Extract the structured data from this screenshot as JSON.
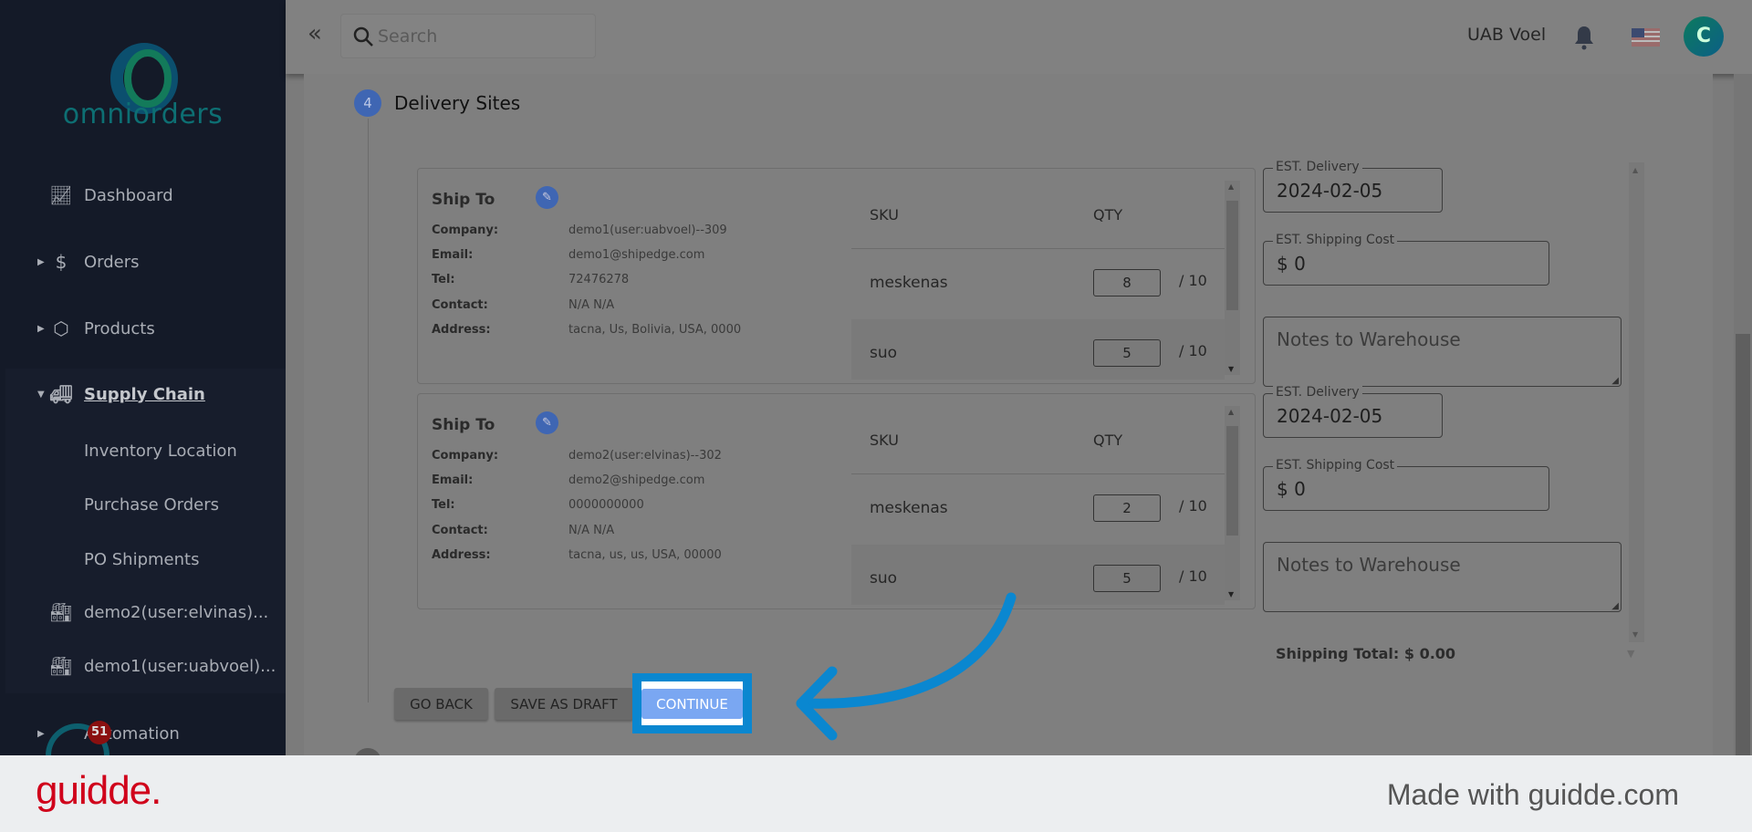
{
  "brand": {
    "name": "omniorders"
  },
  "sidebar": {
    "items": [
      {
        "label": "Dashboard",
        "icon": "chart-line-icon"
      },
      {
        "label": "Orders",
        "icon": "dollar-icon"
      },
      {
        "label": "Products",
        "icon": "box-icon"
      },
      {
        "label": "Supply Chain",
        "icon": "truck-icon"
      },
      {
        "label": "Inventory Location"
      },
      {
        "label": "Purchase Orders"
      },
      {
        "label": "PO Shipments"
      },
      {
        "label": "demo2(user:elvinas)...",
        "icon": "warehouse-icon"
      },
      {
        "label": "demo1(user:uabvoel)...",
        "icon": "warehouse-icon"
      },
      {
        "label": "Automation",
        "icon": "gear-icon"
      }
    ],
    "badge": "51"
  },
  "header": {
    "search_placeholder": "Search",
    "company": "UAB Voel",
    "avatar_initial": "C"
  },
  "step": {
    "number": "4",
    "title": "Delivery Sites"
  },
  "labels": {
    "ship_to": "Ship To",
    "company": "Company:",
    "email": "Email:",
    "tel": "Tel:",
    "contact": "Contact:",
    "address": "Address:",
    "sku": "SKU",
    "qty": "QTY",
    "est_delivery": "EST. Delivery",
    "est_cost": "EST. Shipping Cost",
    "notes_placeholder": "Notes to Warehouse"
  },
  "sites": [
    {
      "company": "demo1(user:uabvoel)--309",
      "email": "demo1@shipedge.com",
      "tel": "72476278",
      "contact": "N/A N/A",
      "address": "tacna, Us, Bolivia, USA, 0000",
      "items": [
        {
          "sku": "meskenas",
          "qty": "8",
          "max": "/ 10"
        },
        {
          "sku": "suo",
          "qty": "5",
          "max": "/ 10"
        }
      ],
      "est_delivery": "2024-02-05",
      "est_cost": "$ 0"
    },
    {
      "company": "demo2(user:elvinas)--302",
      "email": "demo2@shipedge.com",
      "tel": "0000000000",
      "contact": "N/A N/A",
      "address": "tacna, us, us, USA, 00000",
      "items": [
        {
          "sku": "meskenas",
          "qty": "2",
          "max": "/ 10"
        },
        {
          "sku": "suo",
          "qty": "5",
          "max": "/ 10"
        }
      ],
      "est_delivery": "2024-02-05",
      "est_cost": "$ 0"
    }
  ],
  "shipping_total": "Shipping Total: $ 0.00",
  "actions": {
    "go_back": "GO BACK",
    "save_draft": "SAVE AS DRAFT",
    "continue": "CONTINUE"
  },
  "footer": {
    "logo": "guidde.",
    "tagline": "Made with guidde.com"
  },
  "colors": {
    "highlight": "#0a87d0",
    "continue_bg": "#7aa7f2",
    "guidde_red": "#d0021b",
    "step_blue": "#3f66b3"
  }
}
